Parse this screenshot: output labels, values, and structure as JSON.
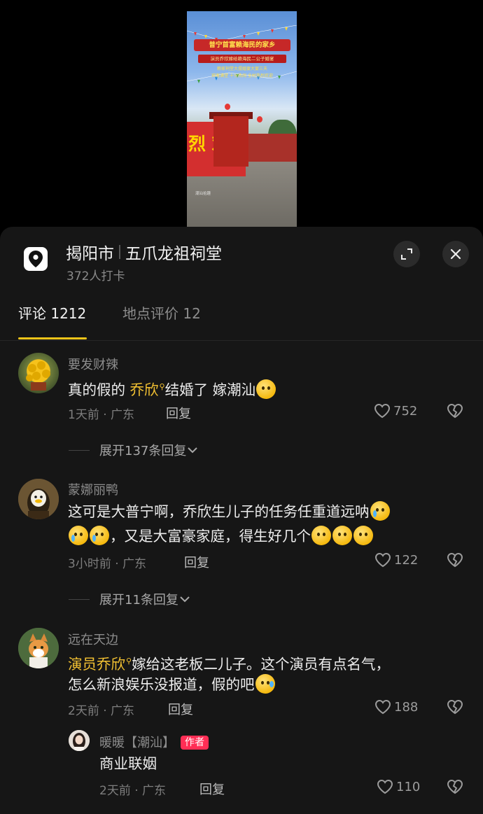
{
  "video": {
    "title": "普宁首富赖海民的家乡",
    "subtitle": "演员乔欣嫁给赖海民二公子婚宴",
    "lines": [
      "赖家祠堂大摆婚宴大宴三天",
      "宾客满堂 十分热闹 全村热烈欢迎"
    ],
    "banner_text": "烈 欢",
    "watermark": "潮汕拾趣"
  },
  "location": {
    "city": "揭阳市",
    "place": "五爪龙祖祠堂",
    "checkins": "372人打卡",
    "pin_icon": "location-pin-icon"
  },
  "tabs": [
    {
      "label": "评论 1212",
      "active": true
    },
    {
      "label": "地点评价 12",
      "active": false
    }
  ],
  "comments": [
    {
      "username": "要发财辣",
      "text_before": "真的假的 ",
      "highlight": "乔欣",
      "text_after": "结婚了 嫁潮汕",
      "meta": "1天前 · 广东",
      "reply_label": "回复",
      "likes": "752",
      "expand_label": "展开137条回复"
    },
    {
      "username": "蒙娜丽鸭",
      "line1": "这可是大普宁啊，乔欣生儿子的任务任重道远呐",
      "line2_mid": "，又是大富豪家庭，得生好几个",
      "meta": "3小时前 · 广东",
      "reply_label": "回复",
      "likes": "122",
      "expand_label": "展开11条回复"
    },
    {
      "username": "远在天边",
      "highlight": "演员乔欣",
      "line1_after": "嫁给这老板二儿子。这个演员有点名气，",
      "line2": "怎么新浪娱乐没报道，假的吧",
      "meta": "2天前 · 广东",
      "reply_label": "回复",
      "likes": "188"
    }
  ],
  "reply": {
    "username": "暖暖【潮汕】",
    "badge": "作者",
    "text": "商业联姻",
    "meta": "2天前 · 广东",
    "reply_label": "回复",
    "likes": "110"
  },
  "colors": {
    "accent": "#f0c419",
    "highlight": "#f4c232",
    "author_badge": "#ff2e55",
    "panel_bg": "#161616"
  }
}
